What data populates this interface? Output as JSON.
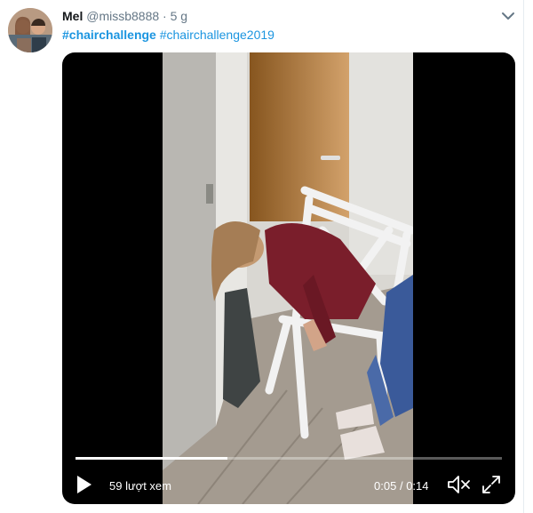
{
  "tweet": {
    "author_name": "Mel",
    "author_handle": "@missb8888",
    "separator": "·",
    "time_ago": "5 g",
    "hashtags": [
      "#chairchallenge",
      "#chairchallenge2019"
    ]
  },
  "video": {
    "views": "59 lượt xem",
    "current_time": "0:05",
    "duration": "0:14",
    "time_separator": "/",
    "progress": 0.357
  },
  "icons": {
    "menu": "chevron-down-icon",
    "play": "play-icon",
    "mute": "volume-muted-icon",
    "fullscreen": "fullscreen-icon"
  },
  "colors": {
    "hashtag": "#1b95e0",
    "meta_text": "#657786",
    "video_bg": "#000000"
  }
}
